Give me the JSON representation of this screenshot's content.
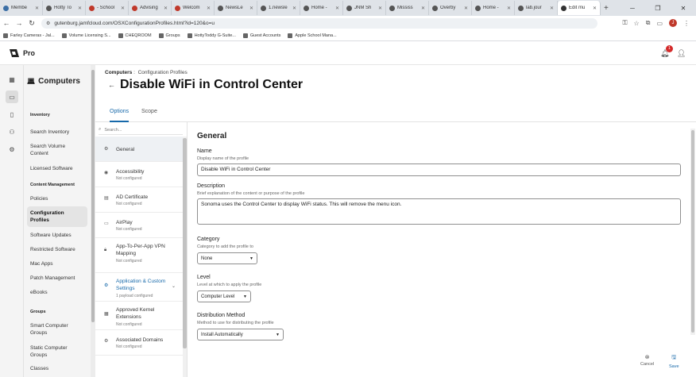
{
  "browser": {
    "tabs": [
      {
        "label": "Membe",
        "color": "#3a6ea5"
      },
      {
        "label": "Hotty To",
        "color": "#555555"
      },
      {
        "label": "- School",
        "color": "#c0392b"
      },
      {
        "label": "Advising",
        "color": "#c0392b"
      },
      {
        "label": "Welcom",
        "color": "#c0392b"
      },
      {
        "label": "NewsLe",
        "color": "#555555"
      },
      {
        "label": "1.newsle",
        "color": "#555555"
      },
      {
        "label": "Home -",
        "color": "#555555"
      },
      {
        "label": "JNM Sh",
        "color": "#555555"
      },
      {
        "label": "Mississ",
        "color": "#555555"
      },
      {
        "label": "Overby",
        "color": "#555555"
      },
      {
        "label": "Home -",
        "color": "#555555"
      },
      {
        "label": "lab.jour",
        "color": "#555555"
      },
      {
        "label": "Edit mu",
        "color": "#333333"
      }
    ],
    "url": "gutenburg.jamfcloud.com/OSXConfigurationProfiles.html?id=120&o=u",
    "profile_initial": "J",
    "bookmarks": [
      "Farley Cameras - Jal...",
      "Volume Licensing S...",
      "CHEQROOM",
      "Groups",
      "HottyToddy G-Suite...",
      "Guest Accounts",
      "Apple School Mana..."
    ]
  },
  "app": {
    "product": "Pro",
    "notification_count": "1"
  },
  "sidebar": {
    "title": "Computers",
    "groups": [
      {
        "label": "Inventory",
        "items": [
          "Search Inventory",
          "Search Volume Content",
          "Licensed Software"
        ]
      },
      {
        "label": "Content Management",
        "items": [
          "Policies",
          "Configuration Profiles",
          "Software Updates",
          "Restricted Software",
          "Mac Apps",
          "Patch Management",
          "eBooks"
        ]
      },
      {
        "label": "Groups",
        "items": [
          "Smart Computer Groups",
          "Static Computer Groups",
          "Classes"
        ]
      }
    ]
  },
  "page": {
    "breadcrumb_root": "Computers",
    "breadcrumb_sep": ":",
    "breadcrumb_leaf": "Configuration Profiles",
    "title": "Disable WiFi in Control Center",
    "tabs": [
      "Options",
      "Scope"
    ],
    "search_placeholder": "Search..."
  },
  "payloads": [
    {
      "name": "General",
      "status": ""
    },
    {
      "name": "Accessibility",
      "status": "Not configured"
    },
    {
      "name": "AD Certificate",
      "status": "Not configured"
    },
    {
      "name": "AirPlay",
      "status": "Not configured"
    },
    {
      "name": "App-To-Per-App VPN Mapping",
      "status": "Not configured"
    },
    {
      "name": "Application & Custom Settings",
      "status": "1 payload configured"
    },
    {
      "name": "Approved Kernel Extensions",
      "status": "Not configured"
    },
    {
      "name": "Associated Domains",
      "status": "Not configured"
    }
  ],
  "form": {
    "section": "General",
    "name_label": "Name",
    "name_hint": "Display name of the profile",
    "name_value": "Disable WiFi in Control Center",
    "desc_label": "Description",
    "desc_hint": "Brief explanation of the content or purpose of the profile",
    "desc_value": "Sonoma uses the Control Center to display WiFi status.  This will remove the menu icon.",
    "category_label": "Category",
    "category_hint": "Category to add the profile to",
    "category_value": "None",
    "level_label": "Level",
    "level_hint": "Level at which to apply the profile",
    "level_value": "Computer Level",
    "dist_label": "Distribution Method",
    "dist_hint": "Method to use for distributing the profile",
    "dist_value": "Install Automatically"
  },
  "actions": {
    "cancel": "Cancel",
    "save": "Save"
  }
}
